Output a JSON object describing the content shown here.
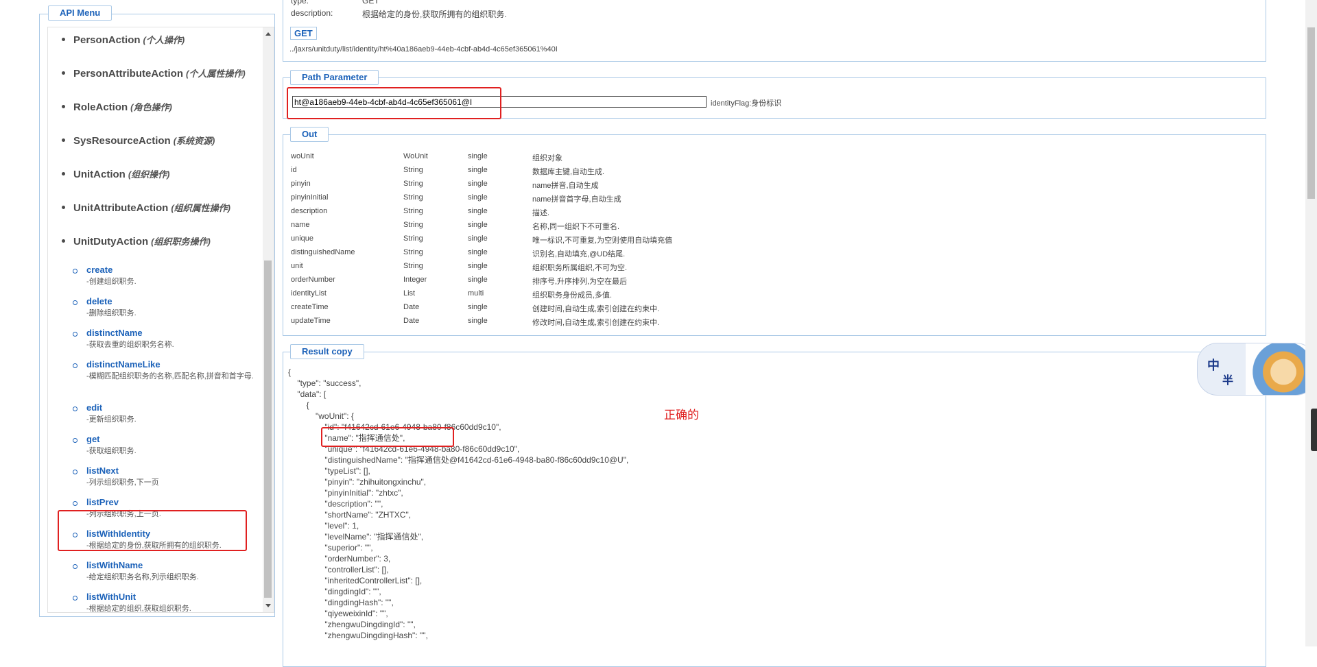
{
  "menu": {
    "legend": "API Menu",
    "actions": [
      {
        "name": "PersonAction",
        "cn": "(个人操作)"
      },
      {
        "name": "PersonAttributeAction",
        "cn": "(个人属性操作)"
      },
      {
        "name": "RoleAction",
        "cn": "(角色操作)"
      },
      {
        "name": "SysResourceAction",
        "cn": "(系统资源)"
      },
      {
        "name": "UnitAction",
        "cn": "(组织操作)"
      },
      {
        "name": "UnitAttributeAction",
        "cn": "(组织属性操作)"
      },
      {
        "name": "UnitDutyAction",
        "cn": "(组织职务操作)"
      }
    ],
    "methods": [
      {
        "name": "create",
        "desc": "-创建组织职务."
      },
      {
        "name": "delete",
        "desc": "-删除组织职务."
      },
      {
        "name": "distinctName",
        "desc": "-获取去重的组织职务名称."
      },
      {
        "name": "distinctNameLike",
        "desc": "-模糊匹配组织职务的名称,匹配名称,拼音和首字母."
      },
      {
        "name": "edit",
        "desc": "-更新组织职务."
      },
      {
        "name": "get",
        "desc": "-获取组织职务."
      },
      {
        "name": "listNext",
        "desc": "-列示组织职务,下一页"
      },
      {
        "name": "listPrev",
        "desc": "-列示组织职务,上一页."
      },
      {
        "name": "listWithIdentity",
        "desc": "-根据给定的身份,获取所拥有的组织职务."
      },
      {
        "name": "listWithName",
        "desc": "-给定组织职务名称,列示组织职务."
      },
      {
        "name": "listWithUnit",
        "desc": "-根据给定的组织,获取组织职务."
      }
    ]
  },
  "top": {
    "type_label": "type:",
    "type_value": "GET",
    "desc_label": "description:",
    "desc_value": "根据给定的身份,获取所拥有的组织职务.",
    "method_button": "GET",
    "url": "../jaxrs/unitduty/list/identity/ht%40a186aeb9-44eb-4cbf-ab4d-4c65ef365061%40I"
  },
  "path_parameter": {
    "legend": "Path Parameter",
    "value": "ht@a186aeb9-44eb-4cbf-ab4d-4c65ef365061@I",
    "hint": "identityFlag:身份标识"
  },
  "out": {
    "legend": "Out",
    "rows": [
      [
        "woUnit",
        "WoUnit",
        "single",
        "组织对象"
      ],
      [
        "id",
        "String",
        "single",
        "数据库主键,自动生成."
      ],
      [
        "pinyin",
        "String",
        "single",
        "name拼音,自动生成"
      ],
      [
        "pinyinInitial",
        "String",
        "single",
        "name拼音首字母,自动生成"
      ],
      [
        "description",
        "String",
        "single",
        "描述."
      ],
      [
        "name",
        "String",
        "single",
        "名称,同一组织下不可重名."
      ],
      [
        "unique",
        "String",
        "single",
        "唯一标识,不可重复,为空则使用自动填充值"
      ],
      [
        "distinguishedName",
        "String",
        "single",
        "识别名,自动填充,@UD结尾."
      ],
      [
        "unit",
        "String",
        "single",
        "组织职务所属组织,不可为空."
      ],
      [
        "orderNumber",
        "Integer",
        "single",
        "排序号,升序排列,为空在最后"
      ],
      [
        "identityList",
        "List",
        "multi",
        "组织职务身份成员,多值."
      ],
      [
        "createTime",
        "Date",
        "single",
        "创建时间,自动生成,索引创建在约束中."
      ],
      [
        "updateTime",
        "Date",
        "single",
        "修改时间,自动生成,索引创建在约束中."
      ]
    ]
  },
  "result": {
    "legend": "Result copy",
    "json": "{\n    \"type\": \"success\",\n    \"data\": [\n        {\n            \"woUnit\": {\n                \"id\": \"f41642cd-61e6-4948-ba80-f86c60dd9c10\",\n                \"name\": \"指挥通信处\",\n                \"unique\": \"f41642cd-61e6-4948-ba80-f86c60dd9c10\",\n                \"distinguishedName\": \"指挥通信处@f41642cd-61e6-4948-ba80-f86c60dd9c10@U\",\n                \"typeList\": [],\n                \"pinyin\": \"zhihuitongxinchu\",\n                \"pinyinInitial\": \"zhtxc\",\n                \"description\": \"\",\n                \"shortName\": \"ZHTXC\",\n                \"level\": 1,\n                \"levelName\": \"指挥通信处\",\n                \"superior\": \"\",\n                \"orderNumber\": 3,\n                \"controllerList\": [],\n                \"inheritedControllerList\": [],\n                \"dingdingId\": \"\",\n                \"dingdingHash\": \"\",\n                \"qiyeweixinId\": \"\",\n                \"zhengwuDingdingId\": \"\",\n                \"zhengwuDingdingHash\": \"\",",
    "annotation": "正确的"
  },
  "widget": {
    "zh": "中",
    "ban": "半"
  }
}
